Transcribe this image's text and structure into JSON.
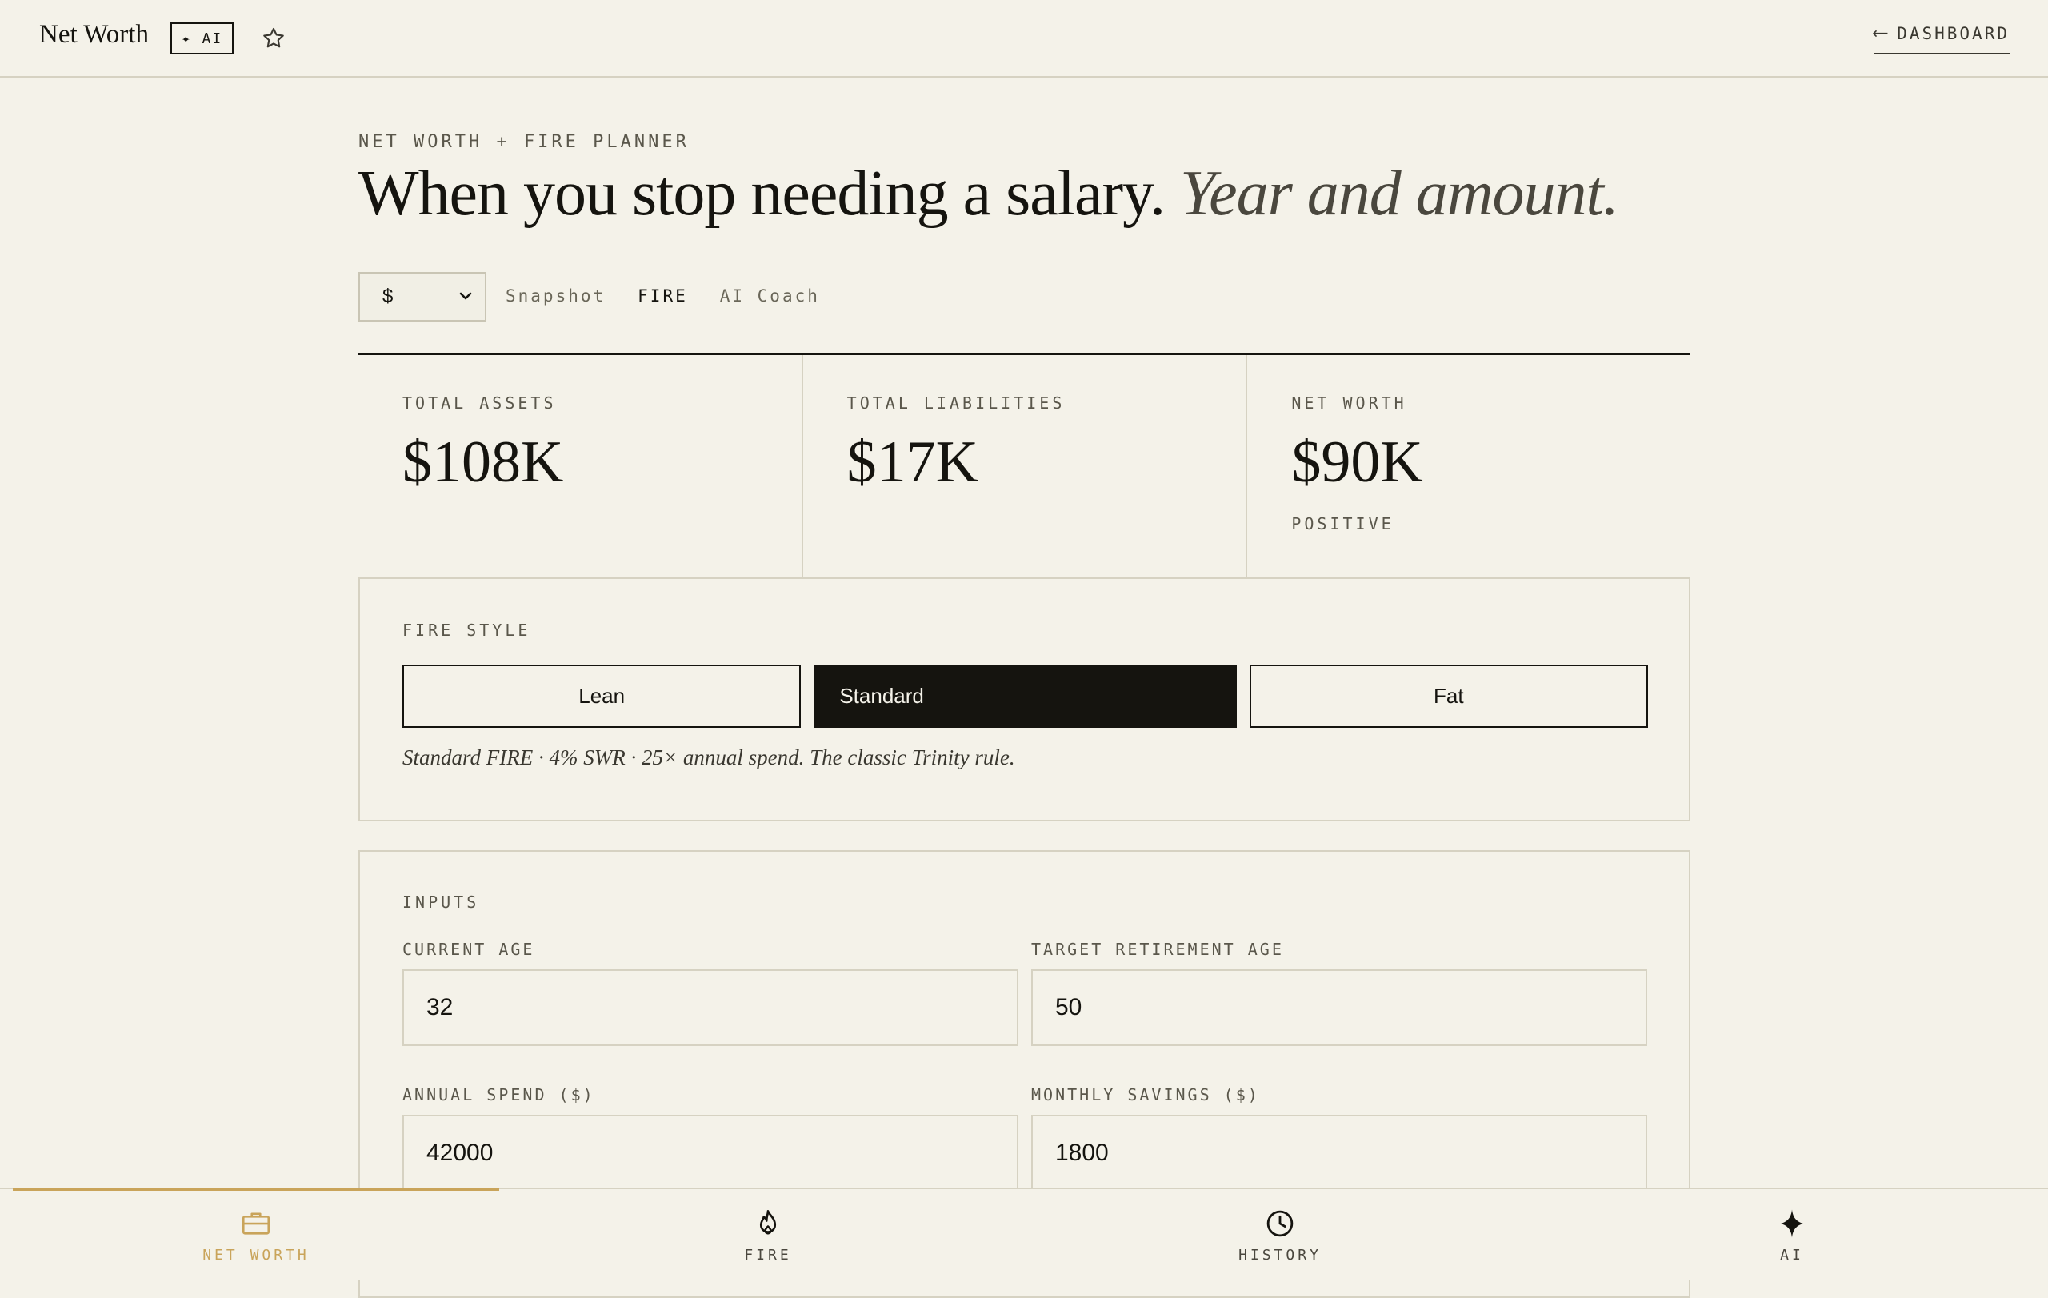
{
  "header": {
    "brand": "Net Worth",
    "ai_badge": "✦ AI",
    "star_icon": "star-icon",
    "back_arrow": "⟵",
    "dashboard_link": "DASHBOARD"
  },
  "hero": {
    "eyebrow": "NET WORTH + FIRE PLANNER",
    "title_main": "When you stop needing a salary.",
    "title_italic": "Year and amount."
  },
  "controls": {
    "currency": "$",
    "tabs": [
      "Snapshot",
      "FIRE",
      "AI Coach"
    ],
    "active_tab": "FIRE"
  },
  "stats": [
    {
      "label": "TOTAL ASSETS",
      "value": "$108K",
      "sub": ""
    },
    {
      "label": "TOTAL LIABILITIES",
      "value": "$17K",
      "sub": ""
    },
    {
      "label": "NET WORTH",
      "value": "$90K",
      "sub": "POSITIVE"
    }
  ],
  "fire_style": {
    "label": "FIRE STYLE",
    "options": [
      "Lean",
      "Standard",
      "Fat"
    ],
    "selected": "Standard",
    "description": "Standard FIRE · 4% SWR · 25× annual spend. The classic Trinity rule."
  },
  "inputs": {
    "label": "INPUTS",
    "current_age": {
      "label": "CURRENT AGE",
      "value": "32"
    },
    "target_age": {
      "label": "TARGET RETIREMENT AGE",
      "value": "50"
    },
    "annual_spend": {
      "label": "ANNUAL SPEND ($)",
      "value": "42000"
    },
    "monthly_savings": {
      "label": "MONTHLY SAVINGS ($)",
      "value": "1800"
    }
  },
  "bottom_nav": {
    "items": [
      {
        "label": "NET WORTH",
        "icon": "briefcase-icon"
      },
      {
        "label": "FIRE",
        "icon": "flame-icon"
      },
      {
        "label": "HISTORY",
        "icon": "clock-icon"
      },
      {
        "label": "AI",
        "icon": "sparkle-icon"
      }
    ],
    "active": "NET WORTH",
    "colors": {
      "active": "#c9a45a",
      "inactive": "#4a473e"
    }
  }
}
